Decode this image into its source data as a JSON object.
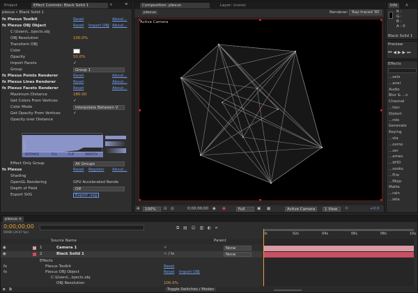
{
  "top_bar": {
    "project_tab": "Project",
    "effect_controls_tab": "Effect Controls: Black Solid 1",
    "composition_tab": "Composition: plexus",
    "layer_tab": "Layer: (none)",
    "info_tab": "Info",
    "audio_tab": "A"
  },
  "effect_controls": {
    "breadcrumb": "plexus • Black Solid 1",
    "rows": [
      {
        "label": "fx Plexus Toolkit",
        "bold": true,
        "reset": "Reset",
        "about": "About..."
      },
      {
        "label": "fx Plexus OBJ Object",
        "bold": true,
        "reset": "Reset",
        "extra": "Import OBJ",
        "about": "About..."
      },
      {
        "label": "C:\\Users\\...bjects.obj"
      },
      {
        "label": "OBJ Resolution",
        "value": "100.0%"
      },
      {
        "label": "Transform OBJ"
      },
      {
        "label": "Color"
      },
      {
        "label": "Opacity",
        "value": "50.0%"
      },
      {
        "label": "Import Facets"
      },
      {
        "label": "Group",
        "dropdown": "Group 1"
      },
      {
        "label": "fx Plexus Points Renderer",
        "bold": true,
        "reset": "Reset",
        "about": "About..."
      },
      {
        "label": "fx Plexus Lines Renderer",
        "bold": true,
        "reset": "Reset",
        "about": "About..."
      },
      {
        "label": "fx Plexus Facets Renderer",
        "bold": true,
        "reset": "Reset",
        "about": "About..."
      },
      {
        "label": "Maximum Distance",
        "value": "280.00"
      },
      {
        "label": "Get Colors From Vertices"
      },
      {
        "label": "Color Mode",
        "dropdown": "Interpolate Between V"
      },
      {
        "label": "Get Opacity From Vertices"
      },
      {
        "label": "Opacity over Distance"
      }
    ],
    "graph_labels": {
      "y": "OPACITY",
      "x": "DISTANCE",
      "b1": "FILL",
      "b2": "FLIP",
      "b3": "SMOOTH"
    },
    "lower_rows": [
      {
        "label": "Effect Only Group",
        "dropdown": "All Groups"
      },
      {
        "label": "fx Plexus",
        "bold": true,
        "reset": "Reset",
        "extra": "Register",
        "about": "About..."
      },
      {
        "label": "Shading"
      },
      {
        "label": "OpenGL Rendering",
        "value": "GPU Accelerated Rende"
      },
      {
        "label": "Depth of Field",
        "dropdown": "Off"
      },
      {
        "label": "Export SVG",
        "button": "Export .svg"
      }
    ]
  },
  "composition": {
    "sub_tab": "plexus",
    "renderer_label": "Renderer:",
    "renderer_value": "Ray-traced 3D",
    "camera_label": "Active Camera",
    "footer": {
      "zoom": "100%",
      "timecode": "0;00;00;00",
      "resolution": "Full",
      "camera": "Active Camera",
      "views": "1 View",
      "exposure": "+0.0"
    }
  },
  "info_panel": {
    "r": "R :",
    "g": "G :",
    "b": "B :",
    "a": "A : 0",
    "layer_name": "Black Solid 1"
  },
  "preview_panel": {
    "title": "Preview"
  },
  "effects_panel": {
    "title": "Effects",
    "items": [
      "...sets",
      "...anel",
      "Audio",
      "Blur & ...n",
      "Channel",
      "...tion",
      "Distort",
      "...rols",
      "Generate",
      "Keying",
      "...sta",
      "...osmo",
      "...ser",
      "...ames",
      "...itHD",
      "...sooks",
      "...Fire",
      "...Mojo",
      "Matte",
      "...rain",
      "...lete"
    ]
  },
  "timeline": {
    "tab": "plexus",
    "timecode": "0;00;00;00",
    "timecode_sub": "00000 (29.97 fps)",
    "col_source": "Source Name",
    "col_parent": "Parent",
    "layers": [
      {
        "num": "1",
        "name": "Camera 1",
        "parent": "None"
      },
      {
        "num": "2",
        "name": "Black Solid 1",
        "parent": "None"
      }
    ],
    "sub_rows": [
      {
        "label": "Effects"
      },
      {
        "label": "Plexus Toolkit",
        "reset": "Reset"
      },
      {
        "label": "Plexus OBJ Object",
        "reset": "Reset",
        "extra": "Import OBJ"
      },
      {
        "label": "C:\\Users\\...bjects.obj"
      },
      {
        "label": "OBJ Resolution",
        "value": "100.0%"
      }
    ],
    "ruler": [
      "0s",
      "02s",
      "04s",
      "06s",
      "08s",
      "10s"
    ],
    "footer_label": "Toggle Switches / Modes",
    "colors": {
      "camera_bar": "#d99aa6",
      "solid_bar": "#c94f62"
    }
  }
}
